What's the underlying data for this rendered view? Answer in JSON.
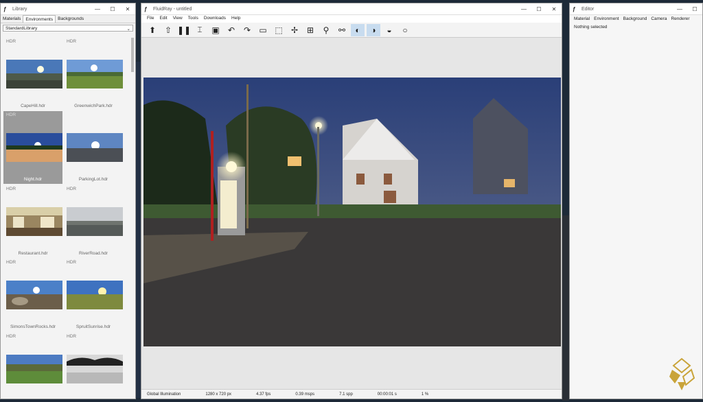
{
  "library": {
    "title": "Library",
    "tabs": [
      "Materials",
      "Environments",
      "Backgrounds"
    ],
    "active_tab": "Environments",
    "dropdown": "StandardLibrary",
    "items": [
      {
        "tag": "HDR",
        "name": "CapeHill.hdr"
      },
      {
        "tag": "HDR",
        "name": "GreenwichPark.hdr"
      },
      {
        "tag": "HDR",
        "name": "Night.hdr",
        "selected": true
      },
      {
        "tag": "",
        "name": "ParkingLot.hdr"
      },
      {
        "tag": "HDR",
        "name": "Restaurant.hdr"
      },
      {
        "tag": "HDR",
        "name": "RiverRoad.hdr"
      },
      {
        "tag": "HDR",
        "name": "SimonsTownRocks.hdr"
      },
      {
        "tag": "HDR",
        "name": "SpruitSunrise.hdr"
      },
      {
        "tag": "HDR",
        "name": ""
      },
      {
        "tag": "HDR",
        "name": ""
      }
    ]
  },
  "main": {
    "title": "FluidRay - untitled",
    "menu": [
      "File",
      "Edit",
      "View",
      "Tools",
      "Downloads",
      "Help"
    ],
    "status": {
      "mode": "Global Illumination",
      "resolution": "1280 x 720 px",
      "fps": "4.37 fps",
      "msps": "0.39 msps",
      "spp": "7.1 spp",
      "time": "00:00:01 s",
      "progress": "1 %"
    }
  },
  "editor": {
    "title": "Editor",
    "tabs": [
      "Material",
      "Environment",
      "Background",
      "Camera",
      "Renderer"
    ],
    "empty": "Nothing selected"
  },
  "colors": {
    "accent": "#c8dcef",
    "brand": "#c9a43a",
    "sky": "#2f4478"
  }
}
